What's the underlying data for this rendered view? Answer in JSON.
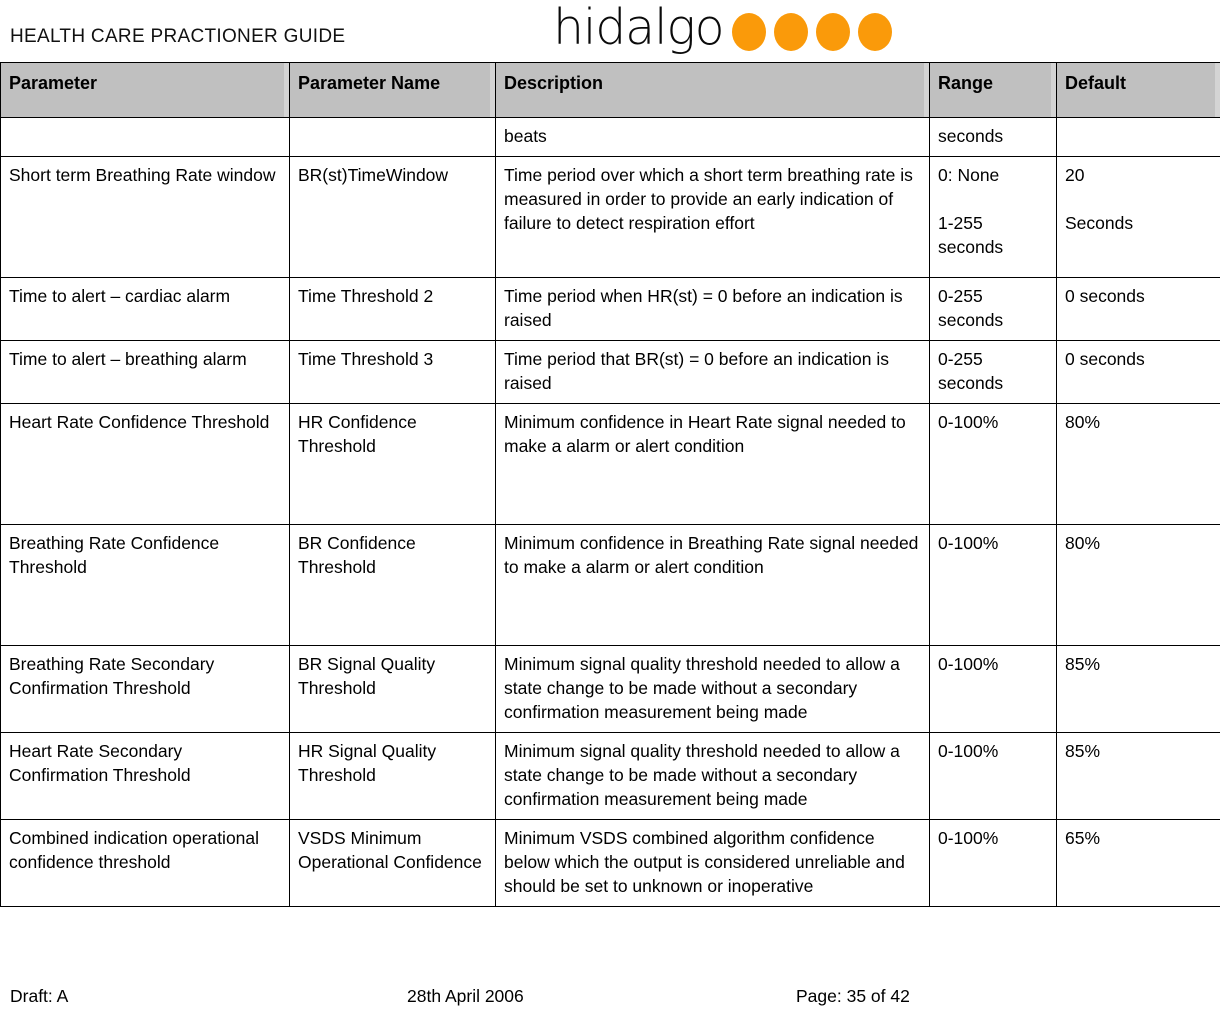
{
  "header": {
    "title": "HEALTH CARE PRACTIONER GUIDE",
    "logo_word": "hidalgo",
    "logo_dot_count": 4,
    "logo_dot_color": "#fa9a0a"
  },
  "table": {
    "columns": [
      "Parameter",
      "Parameter Name",
      "Description",
      "Range",
      "Default"
    ],
    "rows": [
      {
        "parameter": "",
        "parameter_name": "",
        "description": "beats",
        "range": "seconds",
        "default": ""
      },
      {
        "parameter": "Short term Breathing Rate window",
        "parameter_name": "BR(st)TimeWindow",
        "description": "Time period over which a short term breathing rate is measured in order to provide an early indication of failure to detect respiration effort",
        "range_line1": "0: None",
        "range_line2": "1-255 seconds",
        "default_line1": "20",
        "default_line2": "Seconds"
      },
      {
        "parameter": "Time to alert – cardiac alarm",
        "parameter_name": "Time Threshold 2",
        "description": "Time period when HR(st) = 0 before an indication is raised",
        "range": "0-255 seconds",
        "default": "0 seconds"
      },
      {
        "parameter": "Time to alert – breathing alarm",
        "parameter_name": "Time Threshold 3",
        "description": "Time period that BR(st) = 0 before an indication is raised",
        "range": "0-255 seconds",
        "default": "0 seconds"
      },
      {
        "parameter": "Heart Rate Confidence Threshold",
        "parameter_name": "HR Confidence Threshold",
        "description": "Minimum confidence in Heart Rate signal needed to make a alarm or alert condition",
        "range": "0-100%",
        "default": "80%"
      },
      {
        "parameter": "Breathing Rate Confidence Threshold",
        "parameter_name": "BR Confidence Threshold",
        "description": "Minimum confidence in Breathing Rate signal needed to make a alarm or alert condition",
        "range": "0-100%",
        "default": "80%"
      },
      {
        "parameter": "Breathing Rate Secondary Confirmation Threshold",
        "parameter_name": "BR Signal Quality Threshold",
        "description": "Minimum signal quality threshold needed to allow a state change to be made without a secondary confirmation measurement being made",
        "range": "0-100%",
        "default": "85%"
      },
      {
        "parameter": "Heart Rate Secondary Confirmation Threshold",
        "parameter_name": "HR Signal Quality Threshold",
        "description": "Minimum signal quality threshold needed to allow a state change to be made without a secondary confirmation measurement being made",
        "range": "0-100%",
        "default": "85%"
      },
      {
        "parameter": "Combined indication operational confidence threshold",
        "parameter_name": "VSDS Minimum Operational Confidence",
        "description": "Minimum VSDS combined algorithm confidence below which the output is considered unreliable and should be set to unknown or inoperative",
        "range": "0-100%",
        "default": "65%"
      }
    ]
  },
  "footer": {
    "draft": "Draft: A",
    "date": "28th April 2006",
    "page": "Page: 35 of 42"
  }
}
